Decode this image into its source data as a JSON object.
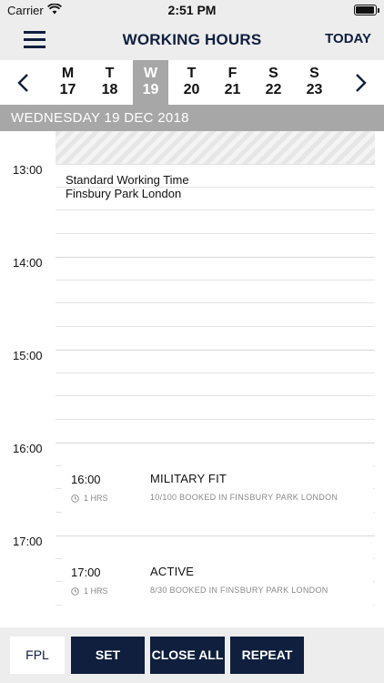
{
  "status_bar": {
    "carrier": "Carrier",
    "time": "2:51 PM",
    "battery_level": 0.95
  },
  "nav": {
    "title": "WORKING HOURS",
    "today_label": "TODAY",
    "menu_icon": "hamburger-menu-icon"
  },
  "week": {
    "prev_icon": "chevron-left-icon",
    "next_icon": "chevron-right-icon",
    "days": [
      {
        "letter": "M",
        "number": "17",
        "selected": false
      },
      {
        "letter": "T",
        "number": "18",
        "selected": false
      },
      {
        "letter": "W",
        "number": "19",
        "selected": true
      },
      {
        "letter": "T",
        "number": "20",
        "selected": false
      },
      {
        "letter": "F",
        "number": "21",
        "selected": false
      },
      {
        "letter": "S",
        "number": "22",
        "selected": false
      },
      {
        "letter": "S",
        "number": "23",
        "selected": false
      }
    ]
  },
  "date_header": "WEDNESDAY 19 DEC 2018",
  "timeline": {
    "hours": [
      "13:00",
      "14:00",
      "15:00",
      "16:00",
      "17:00"
    ],
    "working_time": {
      "title": "Standard Working Time",
      "location": "Finsbury Park London"
    },
    "classes": [
      {
        "time": "16:00",
        "name": "MILITARY FIT",
        "duration": "1 HRS",
        "booked": "10/100 BOOKED IN FINSBURY PARK LONDON"
      },
      {
        "time": "17:00",
        "name": "ACTIVE",
        "duration": "1 HRS",
        "booked": "8/30 BOOKED IN FINSBURY PARK LONDON"
      }
    ]
  },
  "toolbar": {
    "fpl": "FPL",
    "set": "SET",
    "close_all": "CLOSE ALL",
    "repeat": "REPEAT"
  },
  "colors": {
    "navy": "#0f1f3d",
    "grey_bar": "#a7a7a7",
    "light_bg": "#ededed"
  }
}
